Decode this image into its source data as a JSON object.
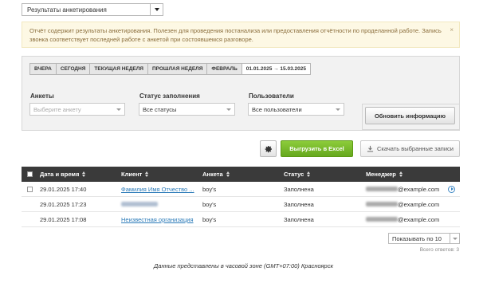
{
  "report_select": {
    "value": "Результаты анкетирования"
  },
  "notice": {
    "text": "Отчёт содержит результаты анкетирования. Полезен для проведения постанализа или предоставления отчётности по проделанной работе. Запись звонка соответствует последней работе с анкетой при состоявшемся разговоре.",
    "close": "×"
  },
  "periods": [
    "ВЧЕРА",
    "СЕГОДНЯ",
    "ТЕКУЩАЯ НЕДЕЛЯ",
    "ПРОШЛАЯ НЕДЕЛЯ",
    "ФЕВРАЛЬ",
    "01.01.2025 → 15.03.2025"
  ],
  "filters": {
    "survey": {
      "label": "Анкеты",
      "placeholder": "Выберите анкету"
    },
    "status": {
      "label": "Статус заполнения",
      "value": "Все статусы"
    },
    "users": {
      "label": "Пользователи",
      "value": "Все пользователи"
    },
    "update_label": "Обновить информацию"
  },
  "actions": {
    "export_label": "Выгрузить в Excel",
    "download_label": "Скачать выбранные записи"
  },
  "table": {
    "headers": {
      "datetime": "Дата и время",
      "client": "Клиент",
      "survey": "Анкета",
      "status": "Статус",
      "manager": "Менеджер"
    },
    "rows": [
      {
        "datetime": "29.01.2025 17:40",
        "client": "Фамилия Имя Отчество ...",
        "survey": "boy's",
        "status": "Заполнена",
        "manager": "@example.com"
      },
      {
        "datetime": "29.01.2025 17:23",
        "client": "",
        "survey": "boy's",
        "status": "Заполнена",
        "manager": "@example.com"
      },
      {
        "datetime": "29.01.2025 17:08",
        "client": "Неизвестная организация",
        "survey": "boy's",
        "status": "Заполнена",
        "manager": "@example.com"
      }
    ]
  },
  "pagination": {
    "page_size_label": "Показывать по 10",
    "total": "Всего ответов: 3"
  },
  "timezone_note": "Данные представлены в часовой зоне (GMT+07:00) Красноярск",
  "colors": {
    "accent_green": "#66a81e",
    "link_blue": "#2a7ab8",
    "header_dark": "#3a3a3a",
    "notice_bg": "#fdf8e4"
  }
}
